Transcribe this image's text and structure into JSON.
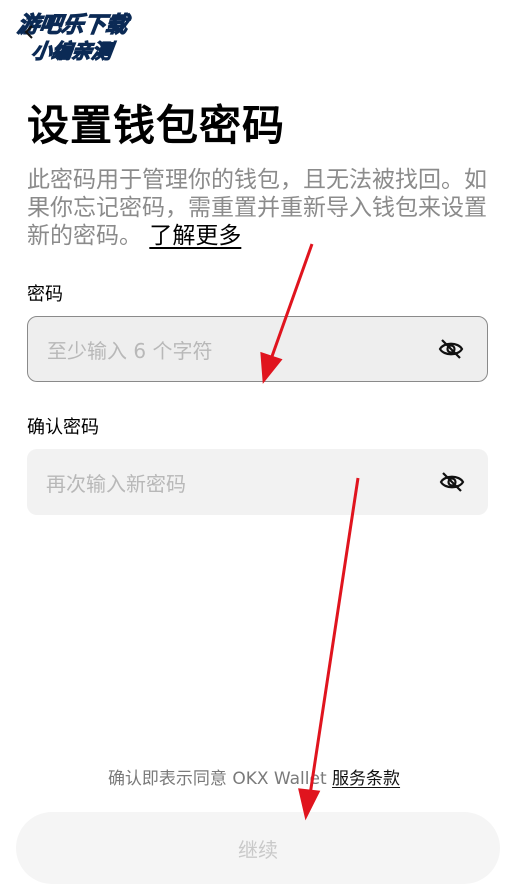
{
  "watermark": {
    "line1": "游吧乐下载",
    "line2": "小编亲测"
  },
  "header": {
    "title": "设置钱包密码"
  },
  "description": {
    "text": "此密码用于管理你的钱包，且无法被找回。如果你忘记密码，需重置并重新导入钱包来设置新的密码。",
    "link": "了解更多"
  },
  "password": {
    "label": "密码",
    "placeholder": "至少输入 6 个字符"
  },
  "confirm": {
    "label": "确认密码",
    "placeholder": "再次输入新密码"
  },
  "footer": {
    "terms_prefix": "确认即表示同意 OKX Wallet ",
    "terms_link": "服务条款",
    "continue_label": "继续"
  },
  "colors": {
    "annotation_arrow": "#e0141e",
    "watermark": "#1ab7e6"
  }
}
